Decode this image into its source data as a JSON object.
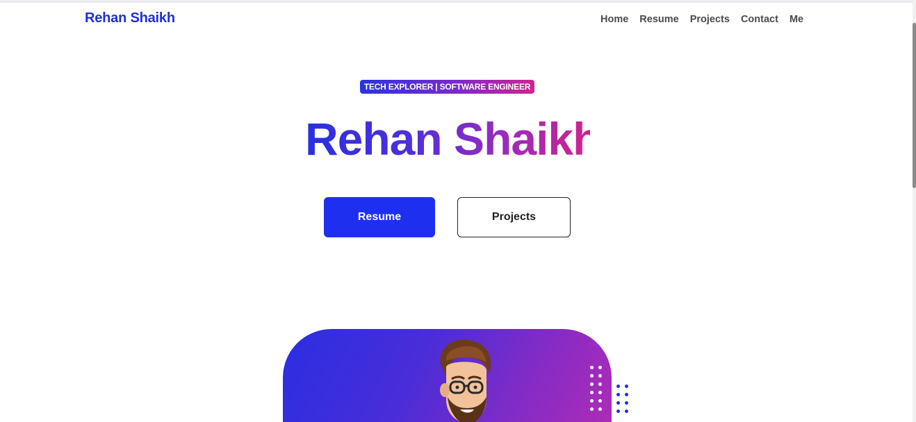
{
  "header": {
    "brand": "Rehan Shaikh",
    "nav": [
      "Home",
      "Resume",
      "Projects",
      "Contact",
      "Me"
    ]
  },
  "hero": {
    "badge": "TECH EXPLORER | SOFTWARE ENGINEER",
    "title": "Rehan Shaikh",
    "primary_button": "Resume",
    "secondary_button": "Projects"
  },
  "colors": {
    "accent": "#1f2ff0",
    "gradient_start": "#2a2fe0",
    "gradient_end": "#d0238d"
  },
  "icons": {
    "avatar": "cartoon-avatar-illustration"
  }
}
